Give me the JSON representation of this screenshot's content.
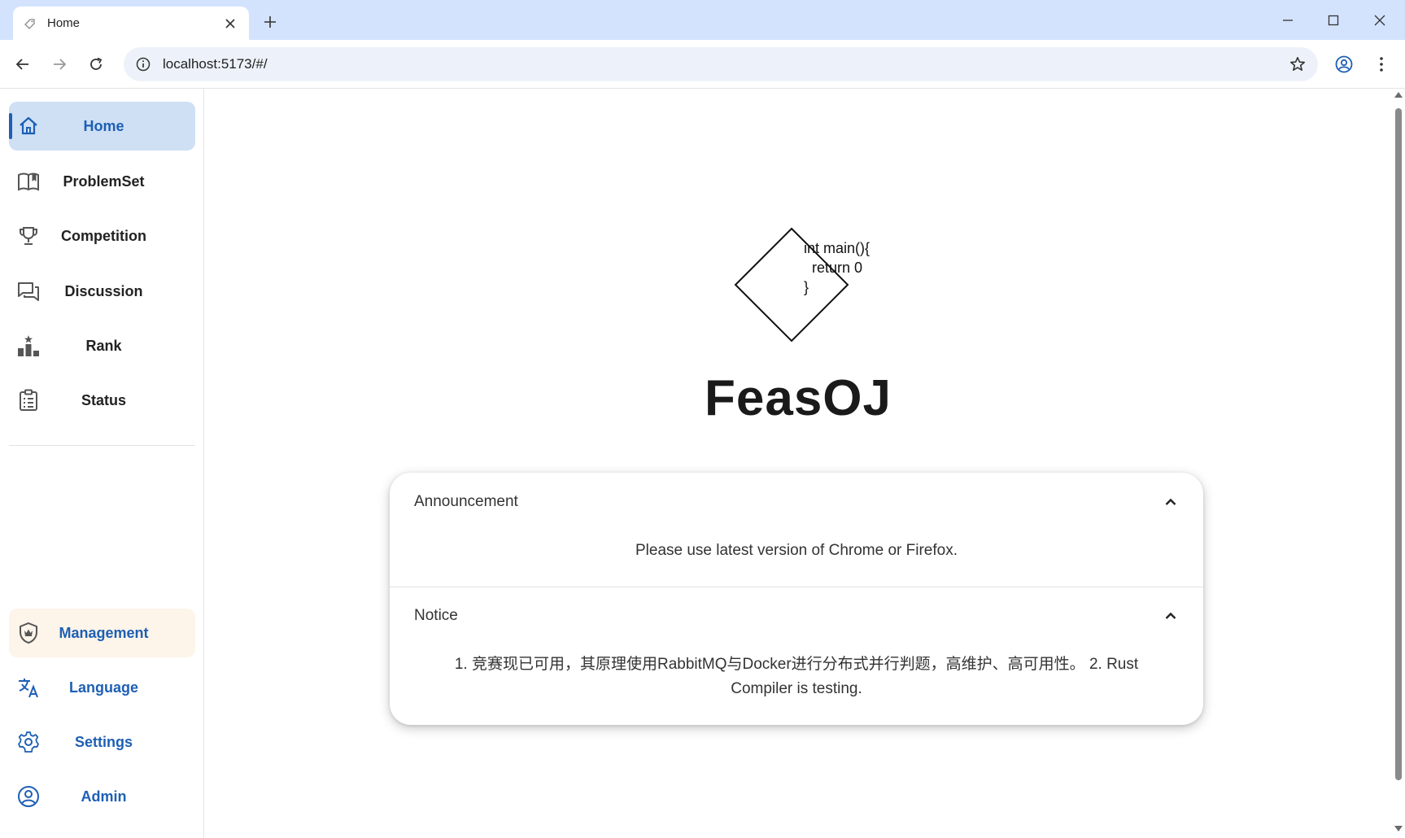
{
  "browser": {
    "tab_title": "Home",
    "url": "localhost:5173/#/"
  },
  "sidebar": {
    "items": [
      {
        "label": "Home",
        "icon": "home-icon"
      },
      {
        "label": "ProblemSet",
        "icon": "book-open-icon"
      },
      {
        "label": "Competition",
        "icon": "trophy-icon"
      },
      {
        "label": "Discussion",
        "icon": "forum-icon"
      },
      {
        "label": "Rank",
        "icon": "podium-icon"
      },
      {
        "label": "Status",
        "icon": "clipboard-list-icon"
      }
    ],
    "bottom_items": [
      {
        "label": "Management",
        "icon": "shield-crown-icon"
      },
      {
        "label": "Language",
        "icon": "translate-icon"
      },
      {
        "label": "Settings",
        "icon": "gear-icon"
      },
      {
        "label": "Admin",
        "icon": "account-circle-icon"
      }
    ]
  },
  "main": {
    "logo_code": [
      "int main(){",
      "return 0",
      "}"
    ],
    "brand": "FeasOJ",
    "panels": [
      {
        "title": "Announcement",
        "body": "Please use latest version of Chrome or Firefox."
      },
      {
        "title": "Notice",
        "body": "1. 竞赛现已可用，其原理使用RabbitMQ与Docker进行分布式并行判题，高维护、高可用性。 2. Rust Compiler is testing."
      }
    ]
  },
  "colors": {
    "accent": "#1d5fb4",
    "active_bg": "#cfe0f5",
    "management_bg": "#fdf4ea",
    "tabbar_bg": "#d3e3fd"
  }
}
